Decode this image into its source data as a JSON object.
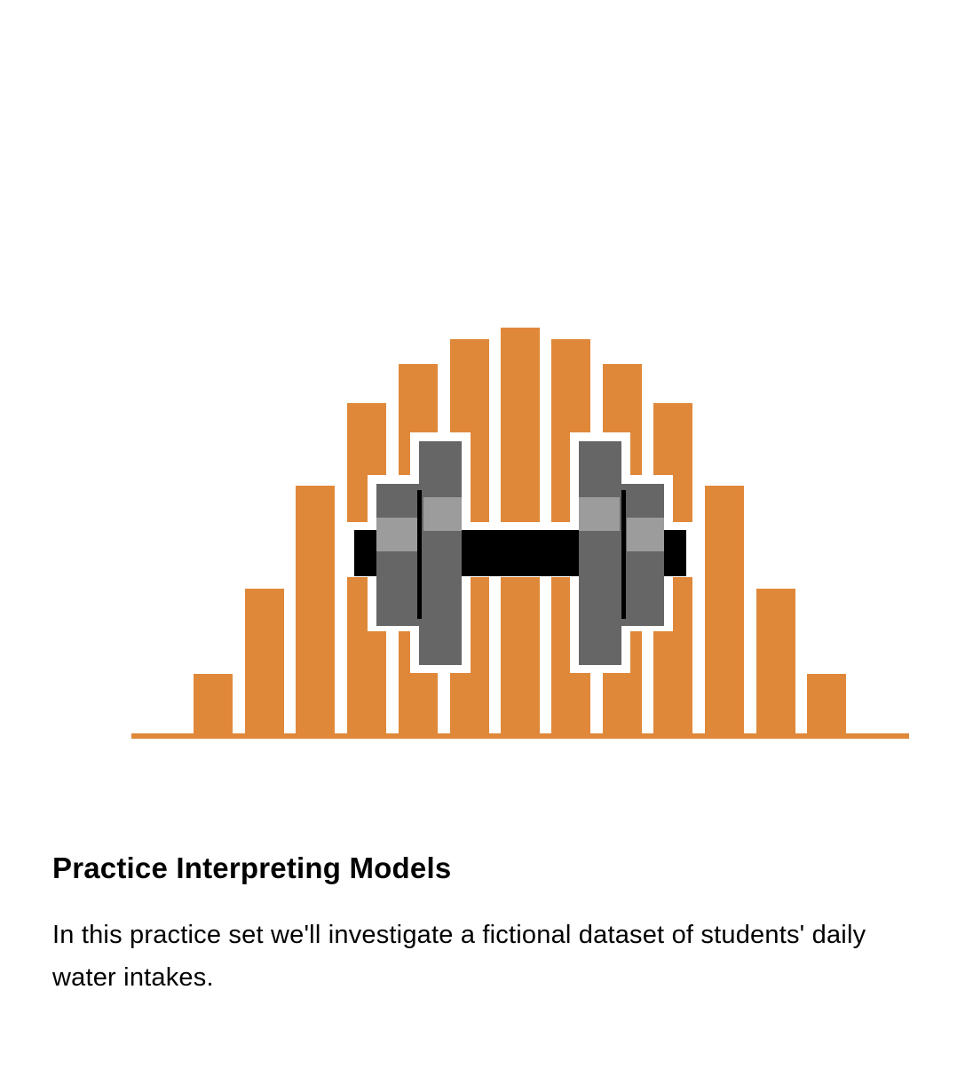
{
  "card": {
    "title": "Practice Interpreting Models",
    "description": "In this practice set we'll investigate a fictional dataset of students' daily water intakes."
  },
  "illustration": {
    "bars_icon": "histogram-bars-icon",
    "dumbbell_icon": "dumbbell-icon",
    "colors": {
      "bar": "#E0883A",
      "plate_dark": "#666666",
      "plate_light": "#9C9C9C",
      "handle": "#000000",
      "outline": "#FFFFFF"
    }
  }
}
